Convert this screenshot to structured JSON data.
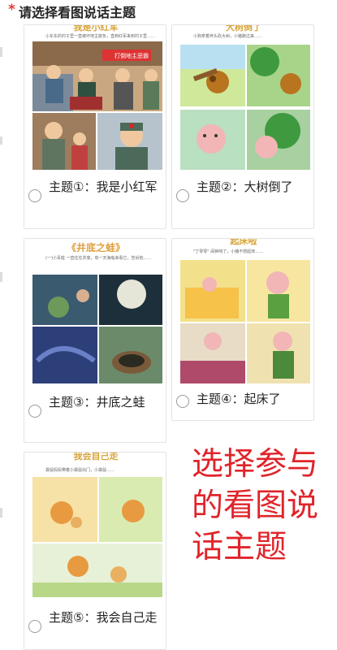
{
  "question": {
    "required_mark": "*",
    "title": "请选择看图说话主题",
    "required_color": "#e53935"
  },
  "options": [
    {
      "id": "opt1",
      "label": "主题①：我是小红军",
      "illustration": {
        "caption_title": "我是小红军",
        "caption_text": "小东东的村子里一直被坏地主欺负，直到红军来到村子里……",
        "banner_text": "打倒地主恶霸",
        "icon": "red-army-scene-image"
      },
      "selected": false
    },
    {
      "id": "opt2",
      "label": "主题②：大树倒了",
      "illustration": {
        "caption_title": "大树倒了",
        "caption_text": "小狗拿着斧头砍大树，小猪跑过来……",
        "icon": "falling-tree-scene-image"
      },
      "selected": false
    },
    {
      "id": "opt3",
      "label": "主题③：井底之蛙",
      "illustration": {
        "caption_title": "《井底之蛙》",
        "caption_text": "(一)小青蛙 一直住在井底，有一天海龟来看它，告诉他……",
        "icon": "frog-in-well-scene-image"
      },
      "selected": false
    },
    {
      "id": "opt4",
      "label": "主题④：起床了",
      "illustration": {
        "caption_title": "起床啦",
        "caption_text": "\"丁零零\" 闹钟响了，小猪不想起床……",
        "icon": "waking-up-scene-image"
      },
      "selected": false
    },
    {
      "id": "opt5",
      "label": "主题⑤：我会自己走",
      "illustration": {
        "caption_title": "我会自己走",
        "caption_text": "袋鼠妈妈带着小袋鼠出门，小袋鼠……",
        "icon": "kangaroo-walking-scene-image"
      },
      "selected": false
    }
  ],
  "overlay_note": {
    "text": "选择参与的看图说话主题",
    "color": "#e0242b"
  },
  "colors": {
    "card_border": "#e3e3e3",
    "radio_border": "#9a9a9a",
    "text": "#222222",
    "caption_gold": "#d8a53a"
  }
}
